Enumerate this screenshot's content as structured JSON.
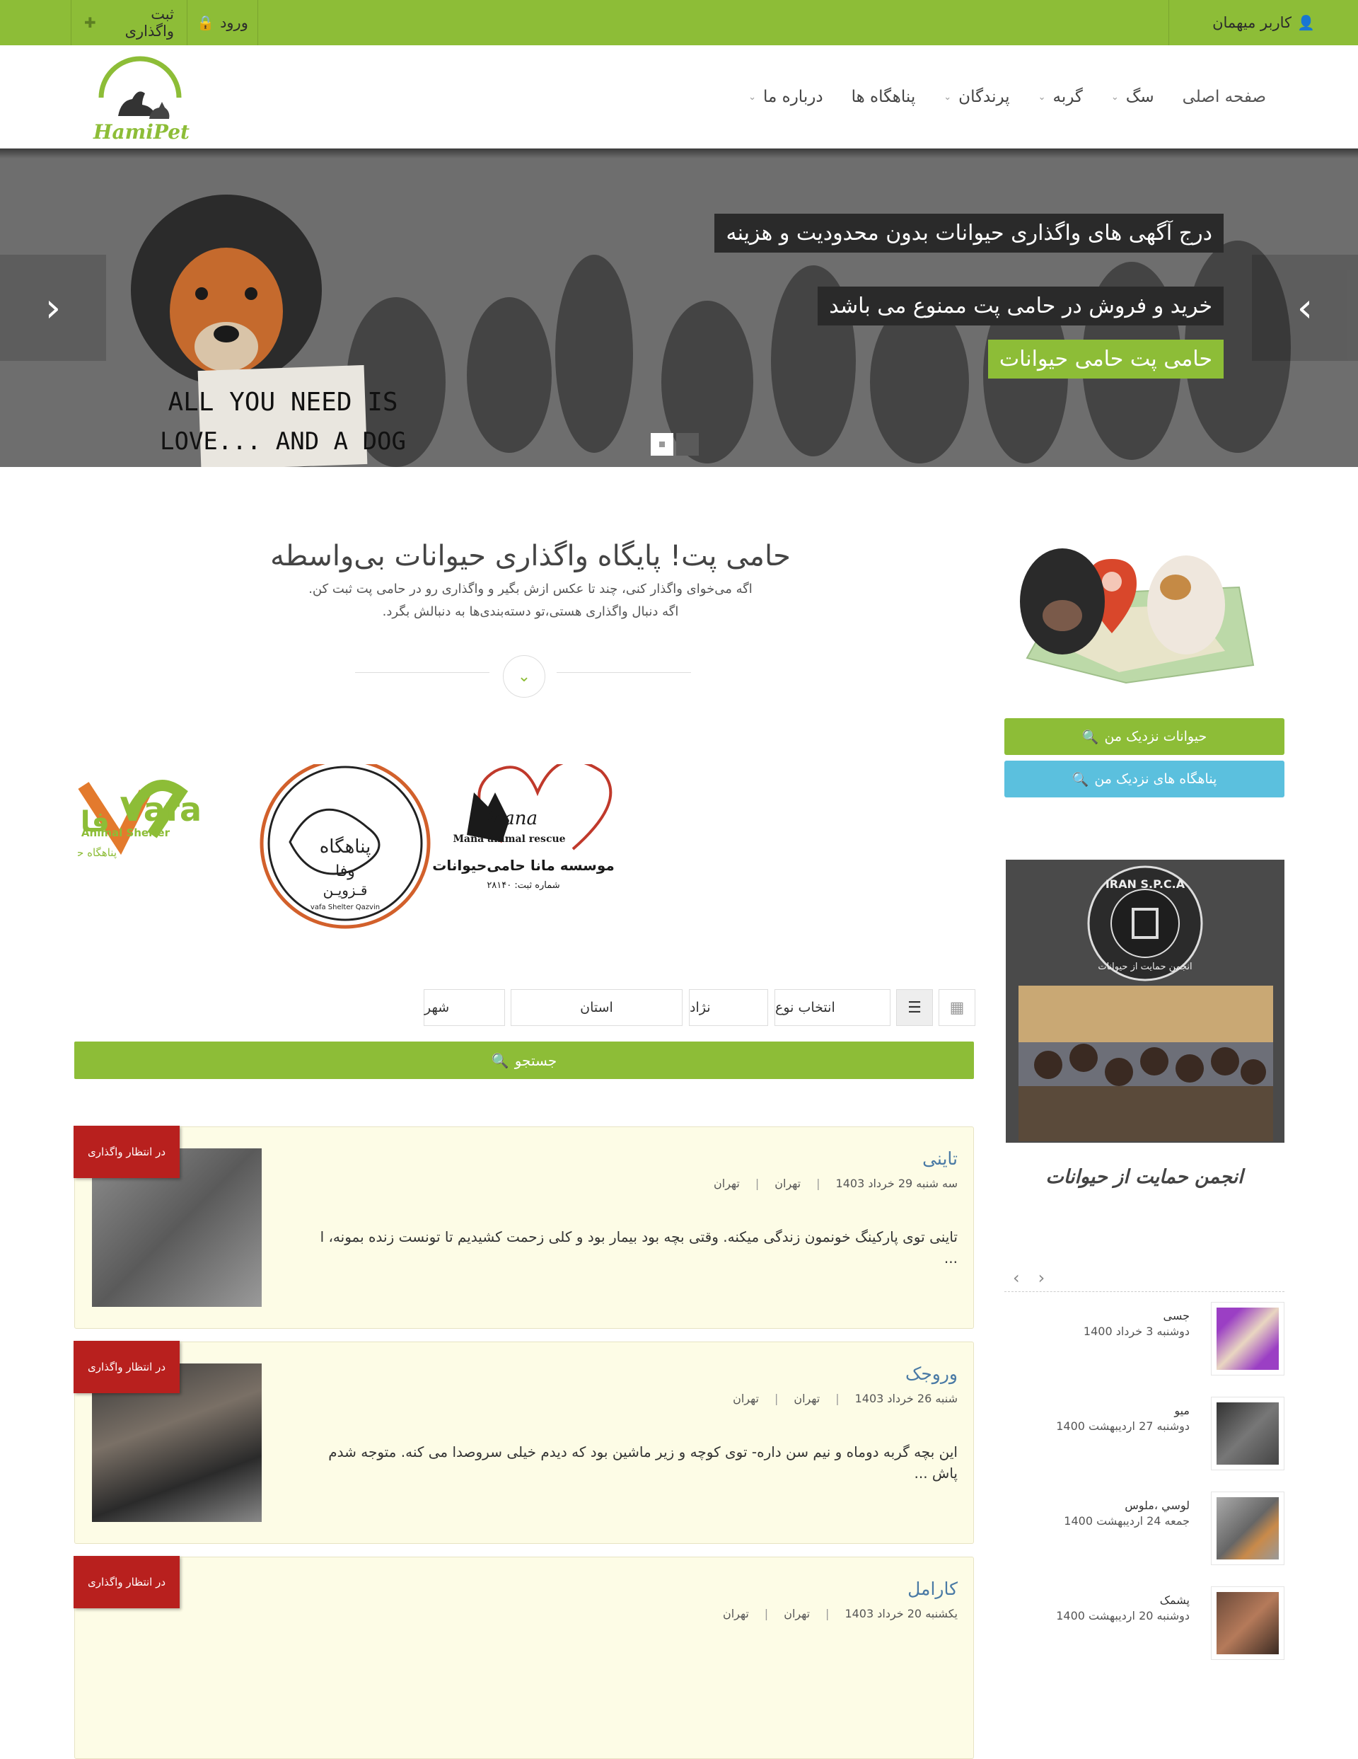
{
  "topbar": {
    "guest_label": "کاربر میهمان",
    "login_label": "ورود",
    "register_label": "ثبت واگذاری"
  },
  "header": {
    "logo_text": "HamiPet",
    "nav": [
      {
        "label": "صفحه اصلی"
      },
      {
        "label": "سگ"
      },
      {
        "label": "گربه"
      },
      {
        "label": "پرندگان"
      },
      {
        "label": "پناهگاه ها"
      },
      {
        "label": "درباره ما"
      }
    ]
  },
  "slider": {
    "captions": [
      "درج آگهی های واگذاری حیوانات بدون محدودیت و هزینه",
      "خرید و فروش در حامی پت ممنوع می باشد",
      "حامی پت حامی حیوانات"
    ],
    "sign_line1": "ALL YOU NEED IS",
    "sign_line2": "LOVE... AND A DOG"
  },
  "main": {
    "title": "حامی پت! پایگاه واگذاری حیوانات بی‌واسطه",
    "subtitle1": "اگه می‌خوای واگذار کنی، چند تا عکس ازش بگیر و واگذاری رو در حامی پت ثبت کن.",
    "subtitle2": "اگه دنبال واگذاری هستی،تو دسته‌بندی‌ها به دنبالش بگرد.",
    "shelters": {
      "vafa_main": "Vafa",
      "vafa_sub": "Animal Shelter",
      "vafa_fa": "پناهگاه حیوانات",
      "vafa_fa2": "فا",
      "qazvin_line1": "پناهگاه",
      "qazvin_line2": "وفا",
      "qazvin_line3": "قـزویـن",
      "qazvin_en": "vafa Shelter Qazvin",
      "mana_script": "Mana",
      "mana_en": "Mana animal rescue",
      "mana_fa": "موسسه مانا حامی‌حیوانات",
      "mana_reg": "شماره ثبت: ۲۸۱۴۰"
    }
  },
  "filters": {
    "type_label": "انتخاب نوع",
    "breed_label": "نژاد",
    "state_label": "استان",
    "city_label": "شهر",
    "search_label": "جستجو"
  },
  "listings": [
    {
      "badge": "در انتظار واگذاری",
      "name": "تاینی",
      "date": "سه شنبه 29 خرداد 1403",
      "province": "تهران",
      "city": "تهران",
      "desc": "تاینی توی پارکینگ خونمون زندگی میکنه. وقتی بچه بود بیمار بود و کلی زحمت کشیدیم تا تونست زنده بمونه، ا ..."
    },
    {
      "badge": "در انتظار واگذاری",
      "name": "وروجک",
      "date": "شنبه 26 خرداد 1403",
      "province": "تهران",
      "city": "تهران",
      "desc": "این بچه گربه دوماه و نیم سن داره- توی کوچه و زیر ماشین بود که دیدم خیلی سروصدا می کنه. متوجه شدم پاش ..."
    },
    {
      "badge": "در انتظار واگذاری",
      "name": "کارامل",
      "date": "یکشنبه 20 خرداد 1403",
      "province": "تهران",
      "city": "تهران",
      "desc": ""
    }
  ],
  "sidebar": {
    "near_pets_label": "حیوانات نزدیک من",
    "near_shelters_label": "پناهگاه های نزدیک من",
    "spca_title": "IRAN S.P.C.A",
    "spca_fa": "انجمن حمایت از حیوانات",
    "spca_caption": "انجمن حمایت از حیوانات",
    "recent": [
      {
        "name": "جسی",
        "date": "دوشنبه 3 خرداد 1400",
        "color": "#9b3fc4"
      },
      {
        "name": "میو",
        "date": "دوشنبه 27 اردیبهشت 1400",
        "color": "#555555"
      },
      {
        "name": "لوسي ،ملوس",
        "date": "جمعه 24 اردیبهشت 1400",
        "color": "#8a8a8a"
      },
      {
        "name": "پشمک",
        "date": "دوشنبه 20 اردیبهشت 1400",
        "color": "#6b4a3a"
      }
    ]
  },
  "colors": {
    "brand_green": "#8dbd37",
    "info_blue": "#5bc0de",
    "badge_red": "#b8201e",
    "card_bg": "#fdfce6"
  }
}
